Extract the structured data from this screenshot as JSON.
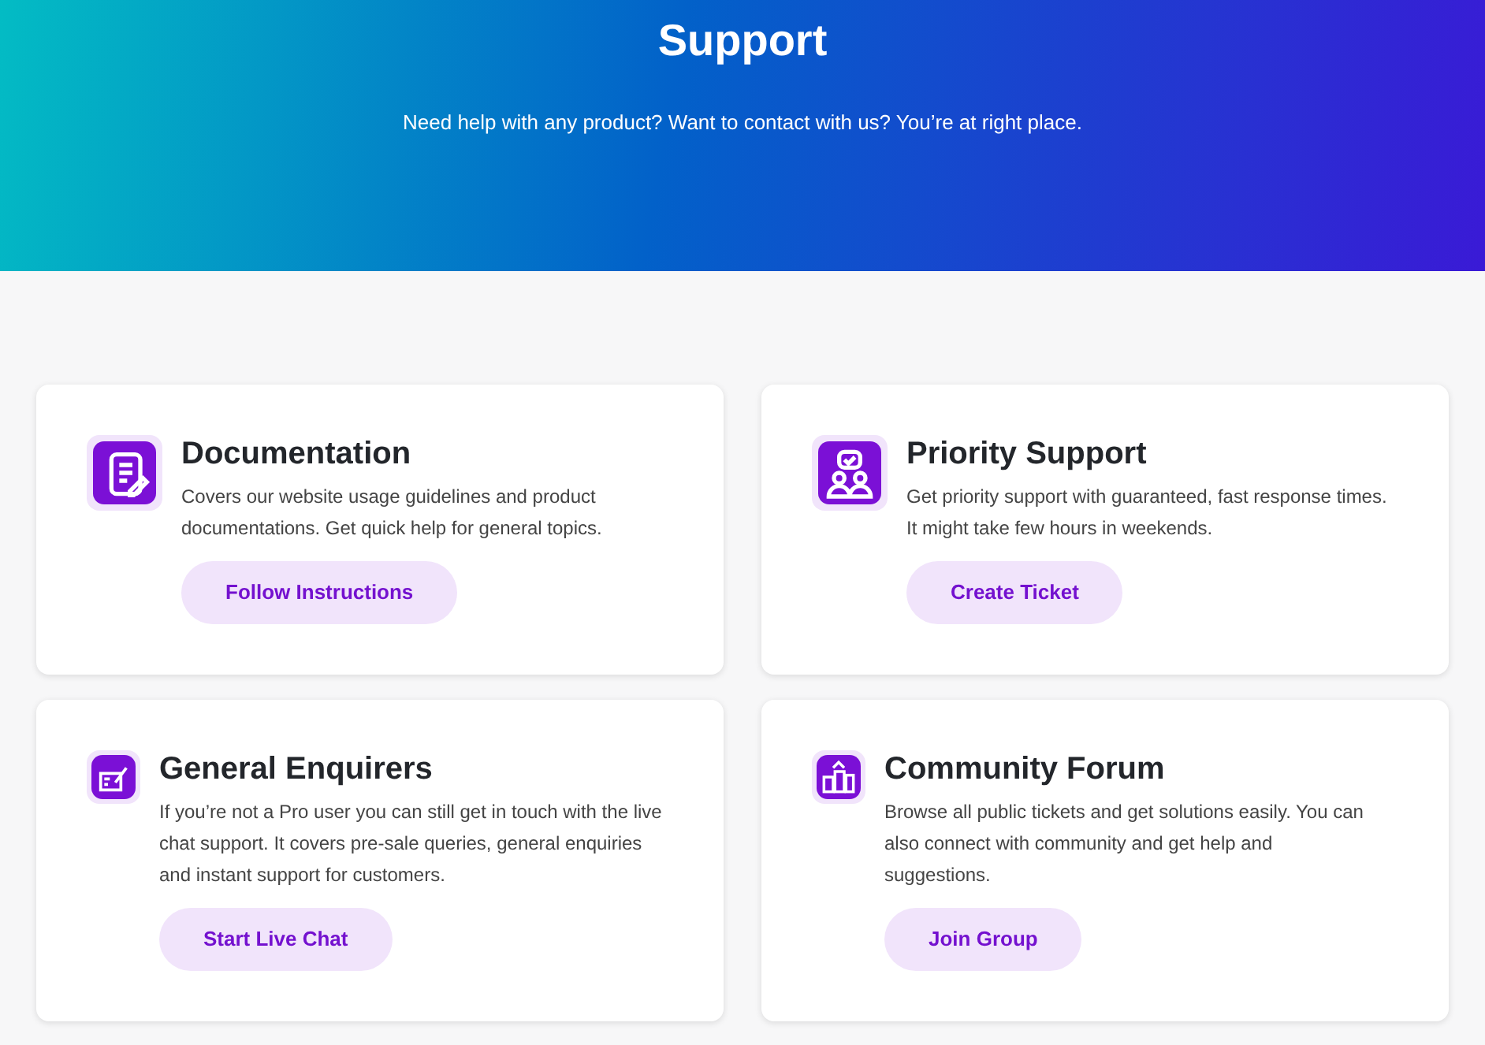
{
  "header": {
    "title": "Support",
    "subtitle": "Need help with any product? Want to contact with us? You’re at right place."
  },
  "cards": [
    {
      "kind": "document",
      "title": "Documentation",
      "description": [
        "Covers our website usage guidelines and product",
        "documentations. Get quick help for general topics."
      ],
      "button": "Follow Instructions"
    },
    {
      "kind": "people",
      "title": "Priority Support",
      "description": [
        "Get priority support with guaranteed, fast response times.",
        "It might take few hours in weekends."
      ],
      "button": "Create Ticket"
    },
    {
      "kind": "chat",
      "title": "General Enquirers",
      "description": [
        "If you’re not a Pro user you can still get in touch with the live",
        "chat support. It covers pre-sale queries, general enquiries",
        "and instant support for customers."
      ],
      "button": "Start Live Chat"
    },
    {
      "kind": "forum",
      "title": "Community Forum",
      "description": [
        "Browse all public tickets and get solutions easily. You can",
        "also connect with community and get help and",
        "suggestions."
      ],
      "button": "Join Group"
    }
  ]
}
